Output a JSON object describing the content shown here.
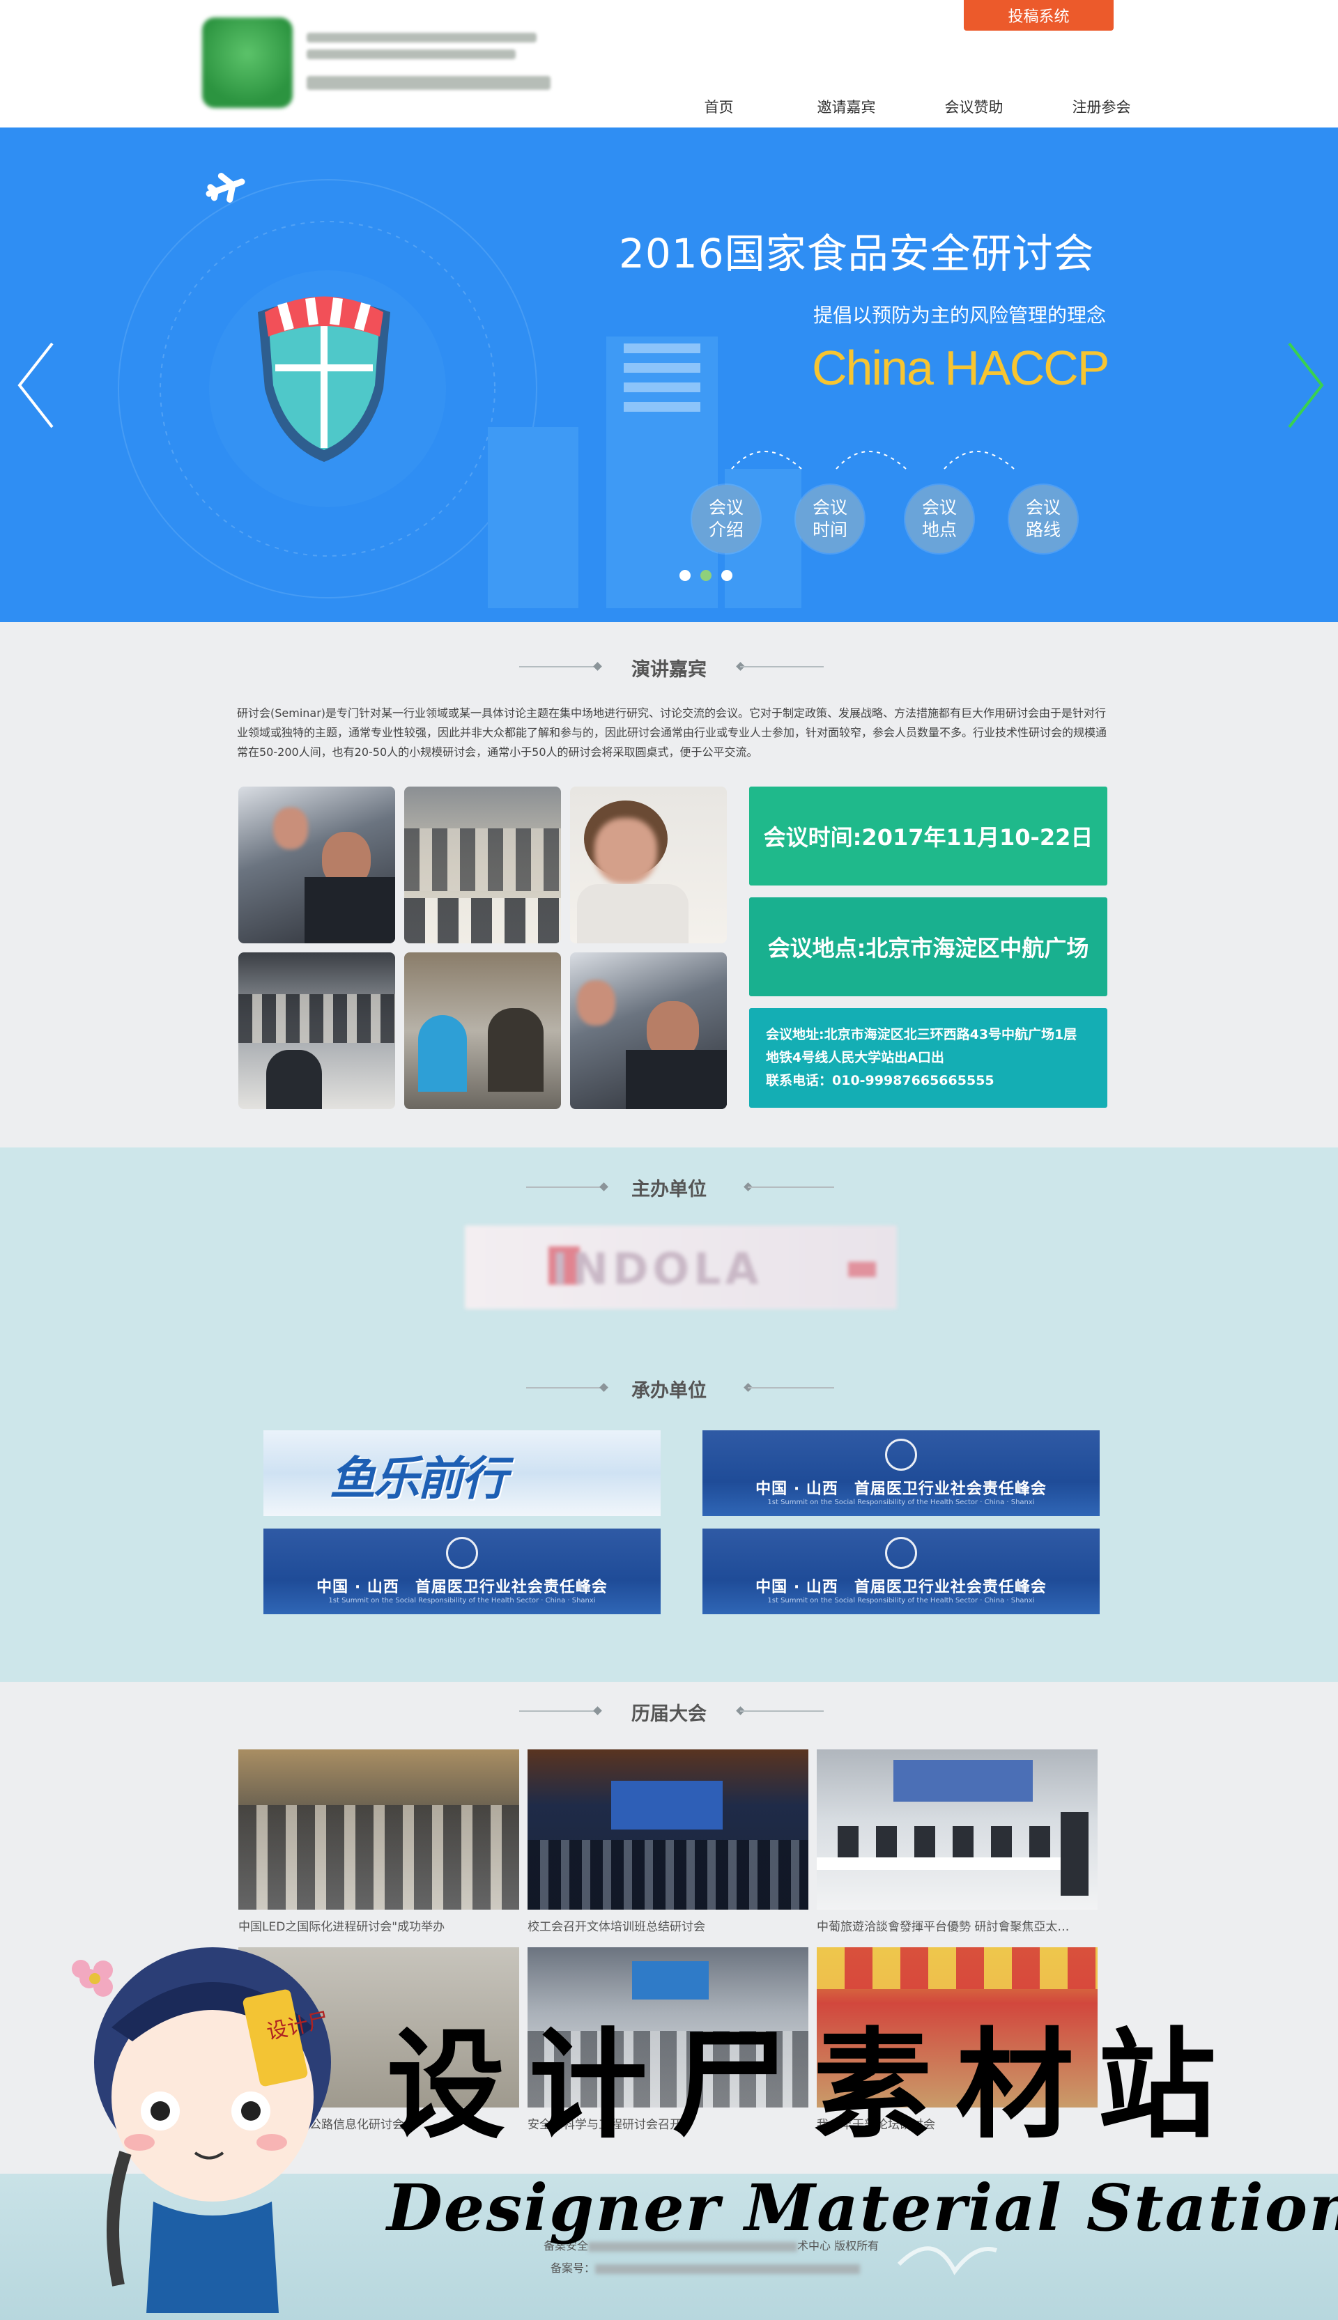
{
  "header": {
    "submit_label": "投稿系统",
    "nav": [
      "首页",
      "邀请嘉宾",
      "会议赞助",
      "注册参会"
    ]
  },
  "banner": {
    "title": "2016国家食品安全研讨会",
    "subtitle": "提倡以预防为主的风险管理的理念",
    "haccp": "China HACCP",
    "circles": [
      "会议\n介绍",
      "会议\n时间",
      "会议\n地点",
      "会议\n路线"
    ],
    "active_slide": 2,
    "slide_count": 3
  },
  "speakers": {
    "title": "演讲嘉宾",
    "intro": "研讨会(Seminar)是专门针对某一行业领域或某一具体讨论主题在集中场地进行研究、讨论交流的会议。它对于制定政策、发展战略、方法措施都有巨大作用研讨会由于是针对行业领域或独特的主题，通常专业性较强，因此并非大众都能了解和参与的，因此研讨会通常由行业或专业人士参加，针对面较窄，参会人员数量不多。行业技术性研讨会的规模通常在50-200人间，也有20-50人的小规模研讨会，通常小于50人的研讨会将采取圆桌式，便于公平交流。",
    "time": "会议时间:2017年11月10-22日",
    "place": "会议地点:北京市海淀区中航广场",
    "address_line1": "会议地址:北京市海淀区北三环西路43号中航广场1层",
    "address_line2": "地铁4号线人民大学站出A口出",
    "phone": "联系电话：010-99987665665555"
  },
  "organizers": {
    "host_title": "主办单位",
    "co_title": "承办单位",
    "sponsor_first": "鱼乐前行",
    "sponsor_blue_title": "中国 · 山西　首届医卫行业社会责任峰会",
    "sponsor_blue_sub": "1st Summit on the Social Responsibility of the Health Sector · China · Shanxi"
  },
  "past": {
    "title": "历届大会",
    "captions": [
      "中国LED之国际化进程研讨会\"成功举办",
      "校工会召开文体培训班总结研讨会",
      "中葡旅遊洽談會發揮平台優勢 研討會聚焦亞太…",
      "首届中国高速公路信息化研讨会",
      "安全…科学与工程研讨会召开",
      "我…年干部论坛研讨会"
    ]
  },
  "footer": {
    "line1_prefix": "备案安全",
    "line1_suffix": "术中心 版权所有",
    "line2_prefix": "备案号："
  },
  "watermark": {
    "cn": "设计尸素材站",
    "en": "Designer Material Station",
    "badge": "设计尸"
  },
  "colors": {
    "banner_bg": "#2f8ef3",
    "accent_orange": "#ec5a2b",
    "info_green": "#1fb98b",
    "info_teal": "#14aeb4",
    "haccp_yellow": "#f7c531"
  }
}
